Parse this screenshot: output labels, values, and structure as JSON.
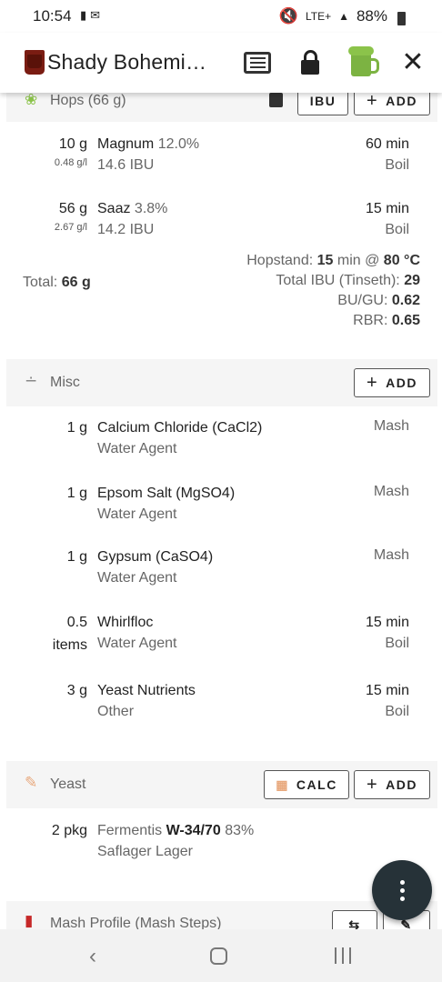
{
  "status": {
    "time": "10:54",
    "network": "LTE+",
    "battery": "88%"
  },
  "app": {
    "title": "Shady Bohemi…"
  },
  "hops": {
    "title": "Hops (66 g)",
    "ibu_label": "IBU",
    "add_label": "ADD",
    "items": [
      {
        "qty": "10 g",
        "rate": "0.48 g/l",
        "name": "Magnum",
        "alpha": "12.0%",
        "ibu": "14.6 IBU",
        "time": "60 min",
        "use": "Boil"
      },
      {
        "qty": "56 g",
        "rate": "2.67 g/l",
        "name": "Saaz",
        "alpha": "3.8%",
        "ibu": "14.2 IBU",
        "time": "15 min",
        "use": "Boil"
      }
    ],
    "total_label": "Total:",
    "total_value": "66 g",
    "hopstand_label": "Hopstand:",
    "hopstand_time": "15",
    "hopstand_unit": "min @",
    "hopstand_temp": "80 °C",
    "ibu_total_label": "Total IBU (Tinseth):",
    "ibu_total_value": "29",
    "bugu_label": "BU/GU:",
    "bugu_value": "0.62",
    "rbr_label": "RBR:",
    "rbr_value": "0.65"
  },
  "misc": {
    "title": "Misc",
    "add_label": "ADD",
    "items": [
      {
        "qty": "1 g",
        "name": "Calcium Chloride (CaCl2)",
        "type": "Water Agent",
        "time": "",
        "use": "Mash"
      },
      {
        "qty": "1 g",
        "name": "Epsom Salt (MgSO4)",
        "type": "Water Agent",
        "time": "",
        "use": "Mash"
      },
      {
        "qty": "1 g",
        "name": "Gypsum (CaSO4)",
        "type": "Water Agent",
        "time": "",
        "use": "Mash"
      },
      {
        "qty": "0.5",
        "qty2": "items",
        "name": "Whirlfloc",
        "type": "Water Agent",
        "time": "15 min",
        "use": "Boil"
      },
      {
        "qty": "3 g",
        "name": "Yeast Nutrients",
        "type": "Other",
        "time": "15 min",
        "use": "Boil"
      }
    ]
  },
  "yeast": {
    "title": "Yeast",
    "calc_label": "CALC",
    "add_label": "ADD",
    "items": [
      {
        "qty": "2 pkg",
        "lab": "Fermentis",
        "code": "W-34/70",
        "atten": "83%",
        "name": "Saflager Lager"
      }
    ]
  },
  "mash": {
    "title": "Mash Profile (Mash Steps)"
  }
}
